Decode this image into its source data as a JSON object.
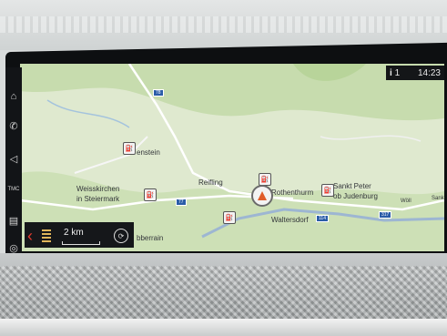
{
  "status": {
    "info_icon": "i",
    "info_count": "1",
    "time": "14:23"
  },
  "map": {
    "places": {
      "p1": "enstein",
      "p2": "Reifling",
      "p3": "Weisskirchen",
      "p4": "in Steiermark",
      "p5": "Rothenthurm",
      "p6": "Sankt Peter",
      "p7": "ob Judenburg",
      "p8": "Waltersdorf",
      "p9": "bberrain",
      "p10": "Wöll",
      "p11": "Sank"
    },
    "road_numbers": {
      "r1": "78",
      "r2": "77",
      "r3": "114",
      "r4": "317"
    }
  },
  "scale": {
    "label": "2 km"
  },
  "side_icons": [
    "navigation-icon",
    "phone-icon",
    "route-icon",
    "tmc-icon",
    "map-book-icon",
    "voice-icon"
  ],
  "tmc_label": "TMC"
}
